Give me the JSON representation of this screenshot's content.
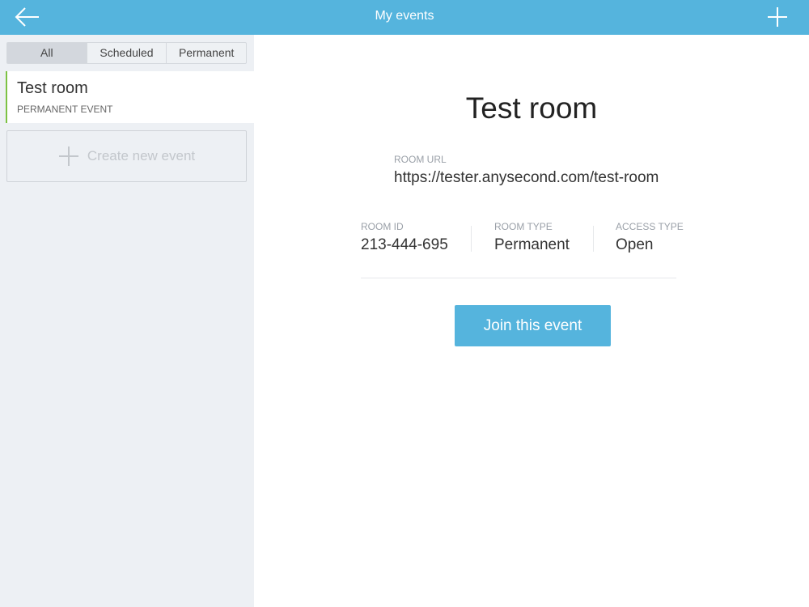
{
  "header": {
    "title": "My events",
    "back_icon": "arrow-left-icon",
    "add_icon": "plus-icon"
  },
  "sidebar": {
    "tabs": [
      {
        "label": "All",
        "selected": true
      },
      {
        "label": "Scheduled"
      },
      {
        "label": "Permanent"
      }
    ],
    "events": [
      {
        "name": "Test room",
        "type": "PERMANENT EVENT"
      }
    ],
    "create_label": "Create new event"
  },
  "detail": {
    "title": "Test room",
    "url_label": "ROOM URL",
    "url": "https://tester.anysecond.com/test-room",
    "room_id_label": "ROOM ID",
    "room_id": "213-444-695",
    "room_type_label": "ROOM TYPE",
    "room_type": "Permanent",
    "access_type_label": "ACCESS TYPE",
    "access_type": "Open",
    "join_label": "Join this event"
  },
  "colors": {
    "accent": "#55b4dd",
    "active_marker": "#7cc243"
  }
}
